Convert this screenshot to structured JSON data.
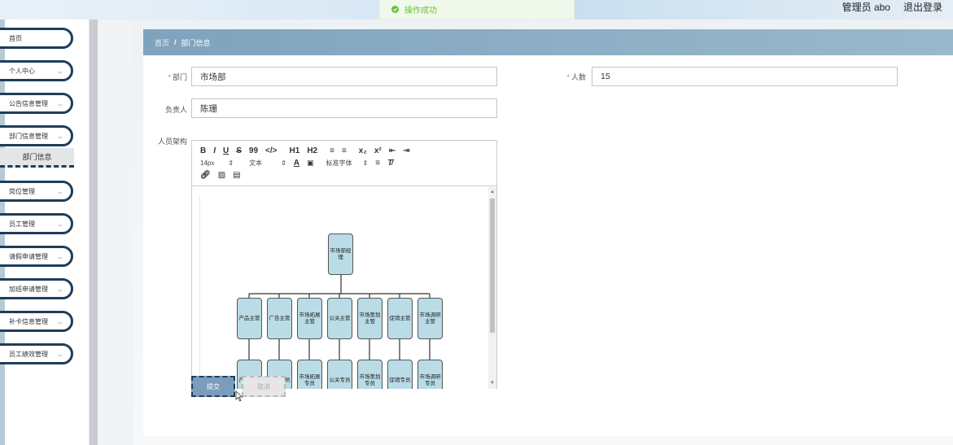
{
  "toast": {
    "message": "操作成功"
  },
  "header": {
    "user_label": "管理员 abo",
    "logout_label": "退出登录"
  },
  "sidebar": {
    "items": [
      {
        "label": "首页",
        "has_arrow": false
      },
      {
        "label": "个人中心",
        "has_arrow": true
      },
      {
        "label": "公告信息管理",
        "has_arrow": true
      },
      {
        "label": "部门信息管理",
        "has_arrow": true
      },
      {
        "label": "岗位管理",
        "has_arrow": true
      },
      {
        "label": "员工管理",
        "has_arrow": true
      },
      {
        "label": "请假申请管理",
        "has_arrow": true
      },
      {
        "label": "加班申请管理",
        "has_arrow": true
      },
      {
        "label": "补卡信息管理",
        "has_arrow": true
      },
      {
        "label": "员工绩效管理",
        "has_arrow": true
      }
    ],
    "active_subitem": "部门信息"
  },
  "breadcrumb": {
    "home": "首页",
    "separator": "/",
    "current": "部门信息"
  },
  "form": {
    "dept_label": "部门",
    "dept_value": "市场部",
    "count_label": "人数",
    "count_value": "15",
    "leader_label": "负责人",
    "leader_value": "陈珊",
    "structure_label": "人员架构"
  },
  "editor": {
    "toolbar_row1": [
      "B",
      "I",
      "U",
      "S",
      "99",
      "</>",
      "H1",
      "H2",
      "≡",
      "≡",
      "x₂",
      "x²",
      "⇤",
      "⇥"
    ],
    "font_size": "14px",
    "text_type": "文本",
    "font_family": "标准字体",
    "org_chart": {
      "root": "市场部经理",
      "managers": [
        "产品主管",
        "广告主管",
        "市场拓展主管",
        "公关主管",
        "市场策划主管",
        "促销主管",
        "市场调研主管"
      ],
      "staff": [
        "产品专员",
        "广告专员",
        "市场拓展专员",
        "公关专员",
        "市场策划专员",
        "促销专员",
        "市场调研专员"
      ]
    }
  },
  "actions": {
    "submit_label": "提交",
    "cancel_label": "取消"
  },
  "colors": {
    "accent_dark": "#1f3d59",
    "breadcrumb": "#7fa3bd",
    "success": "#67c23a",
    "node_fill": "#b9dce6",
    "required": "#f56c6c"
  }
}
